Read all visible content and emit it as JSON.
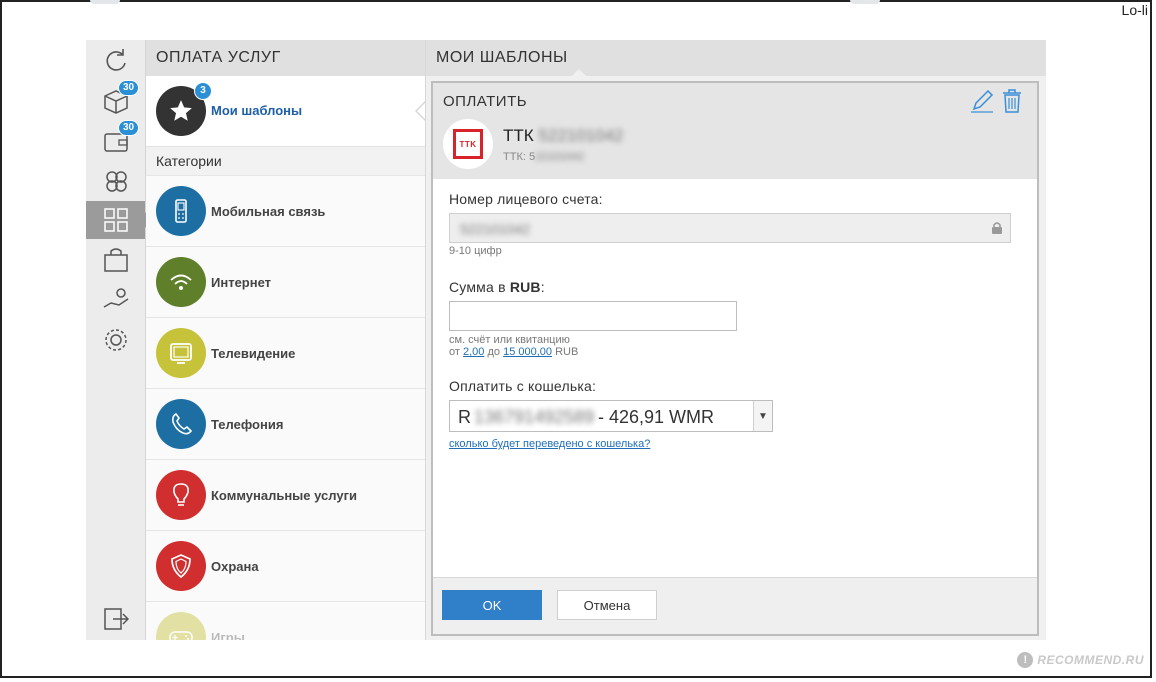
{
  "corner_text": "Lo-li",
  "rail": {
    "badges": [
      "30",
      "30"
    ]
  },
  "categories_panel": {
    "title": "ОПЛАТА УСЛУГ",
    "templates": {
      "label": "Мои шаблоны",
      "badge": "3"
    },
    "categories_header": "Категории",
    "items": [
      {
        "label": "Мобильная связь",
        "color": "#1d6fa3",
        "icon": "mobile-phone-icon"
      },
      {
        "label": "Интернет",
        "color": "#5f7f2a",
        "icon": "wifi-icon"
      },
      {
        "label": "Телевидение",
        "color": "#c6c23a",
        "icon": "tv-icon"
      },
      {
        "label": "Телефония",
        "color": "#1d6fa3",
        "icon": "phone-handset-icon"
      },
      {
        "label": "Коммунальные услуги",
        "color": "#d12f2f",
        "icon": "lightbulb-icon"
      },
      {
        "label": "Охрана",
        "color": "#d12f2f",
        "icon": "shield-icon"
      },
      {
        "label": "Игры",
        "color": "#c6c23a",
        "icon": "gamepad-icon"
      }
    ]
  },
  "main_panel": {
    "title": "МОИ ШАБЛОНЫ",
    "card": {
      "title": "ОПЛАТИТЬ",
      "provider_name": "ТТК",
      "provider_number": "522101042",
      "provider_sub_prefix": "ТТК: 5",
      "provider_sub_masked": "22101042",
      "logo_text": "TTK",
      "account": {
        "label": "Номер лицевого счета:",
        "value": "522101042",
        "hint": "9-10 цифр"
      },
      "amount": {
        "label_prefix": "Сумма в ",
        "currency": "RUB",
        "label_suffix": ":",
        "value": "",
        "hint": "см. счёт или квитанцию",
        "range_from_label": "от",
        "min": "2,00",
        "range_to_label": "до",
        "max": "15 000,00",
        "range_currency": "RUB"
      },
      "wallet": {
        "label": "Оплатить с кошелька:",
        "prefix": "R",
        "masked": "136791492589",
        "balance": "- 426,91 WMR",
        "link": "сколько будет переведено с кошелька?"
      },
      "buttons": {
        "ok": "OK",
        "cancel": "Отмена"
      }
    }
  },
  "watermark": "RECOMMEND.RU",
  "colors": {
    "accent": "#2f7fc9",
    "badge": "#2b8fd6",
    "link": "#1e6fb8"
  }
}
